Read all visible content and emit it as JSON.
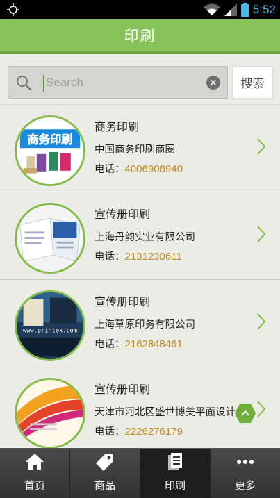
{
  "status_bar": {
    "time": "5:52"
  },
  "header": {
    "title": "印刷"
  },
  "search": {
    "placeholder": "Search",
    "button_label": "搜索"
  },
  "list": {
    "items": [
      {
        "title": "商务印刷",
        "company": "中国商务印刷商圈",
        "phone_label": "电话：",
        "phone": "4006906940",
        "thumb_text": "商务印刷"
      },
      {
        "title": "宣传册印刷",
        "company": "上海丹韵实业有限公司",
        "phone_label": "电话：",
        "phone": "2131230611"
      },
      {
        "title": "宣传册印刷",
        "company": "上海草原印务有限公司",
        "phone_label": "电话：",
        "phone": "2162848461",
        "thumb_text": "www.printex.com"
      },
      {
        "title": "宣传册印刷",
        "company": "天津市河北区盛世博美平面设计",
        "phone_label": "电话：",
        "phone": "2226276179"
      }
    ]
  },
  "bottom_nav": {
    "items": [
      {
        "label": "首页",
        "icon": "home-icon"
      },
      {
        "label": "商品",
        "icon": "tag-icon"
      },
      {
        "label": "印刷",
        "icon": "document-icon",
        "active": true
      },
      {
        "label": "更多",
        "icon": "more-icon"
      }
    ]
  },
  "colors": {
    "header_green": "#88c25a",
    "accent_green": "#82bb46",
    "phone_number": "#c08a1c",
    "status_time": "#4ab6e8"
  }
}
